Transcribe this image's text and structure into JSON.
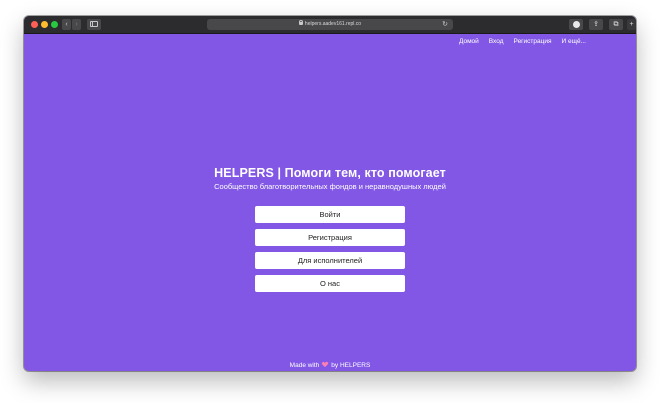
{
  "browser": {
    "url": "helpers.aadev161.repl.co",
    "back_icon": "chevron-left-icon",
    "forward_icon": "chevron-right-icon",
    "reload_glyph": "↻",
    "back_glyph": "‹",
    "forward_glyph": "›",
    "share_glyph": "⇪",
    "tabs_glyph": "⧉",
    "plus_glyph": "+"
  },
  "nav": {
    "items": [
      "Домой",
      "Вход",
      "Регистрация",
      "И ещё..."
    ]
  },
  "hero": {
    "title": "HELPERS | Помоги тем, кто помогает",
    "subtitle": "Сообщество благотворительных фондов и неравнодушных людей"
  },
  "buttons": {
    "login": "Войти",
    "register": "Регистрация",
    "for_executors": "Для исполнителей",
    "about": "О нас"
  },
  "footer": {
    "made_with": "Made with",
    "by": "by HELPERS"
  },
  "colors": {
    "background": "#8257e6",
    "button_bg": "#ffffff",
    "heart": "#ff7eb3"
  }
}
